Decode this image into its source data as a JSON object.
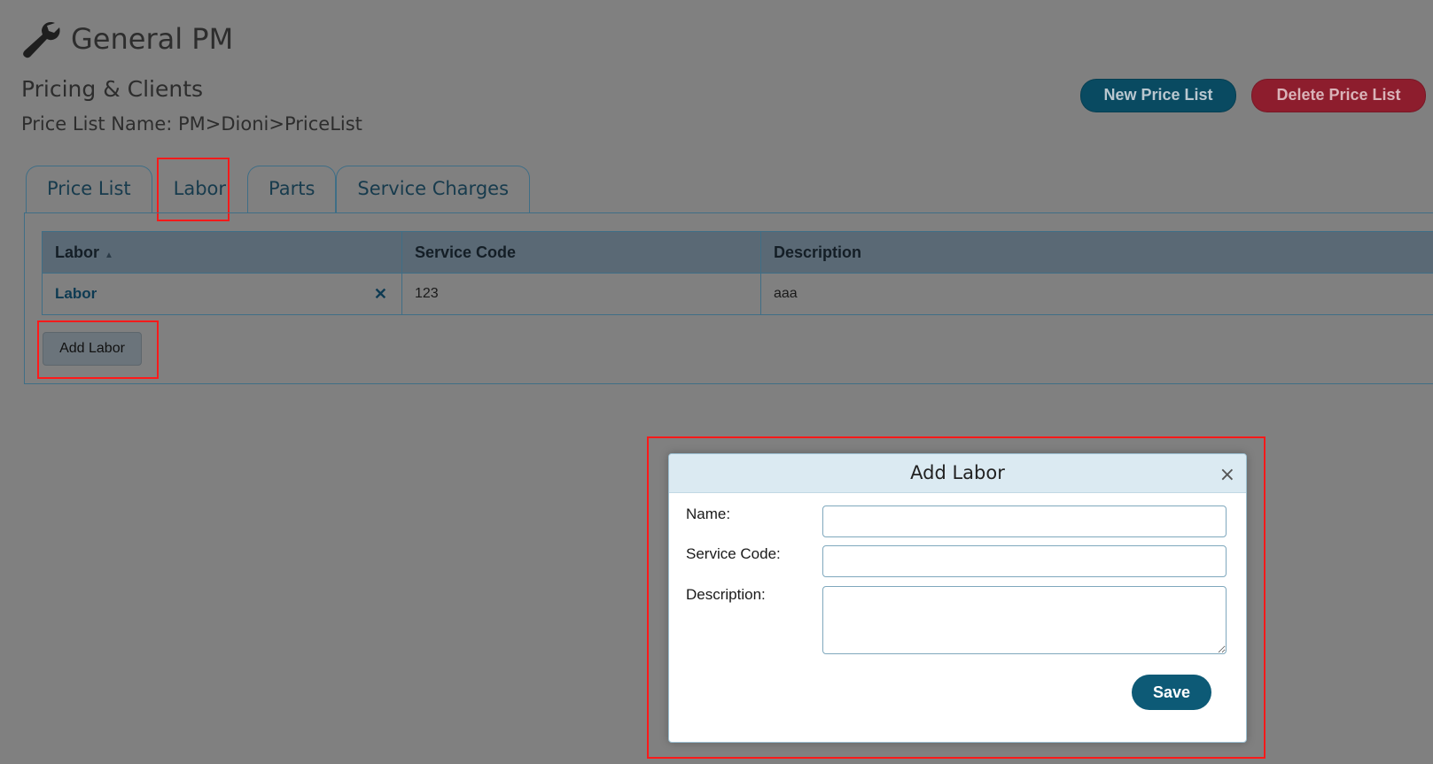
{
  "app": {
    "icon": "wrench-icon",
    "title": "General PM"
  },
  "subtitle": "Pricing & Clients",
  "price_list_name": "Price List Name: PM>Dioni>PriceList",
  "actions": {
    "new_price_list": "New Price List",
    "delete_price_list": "Delete Price List"
  },
  "tabs": [
    {
      "label": "Price List",
      "active": false
    },
    {
      "label": "Labor",
      "active": true
    },
    {
      "label": "Parts",
      "active": false
    },
    {
      "label": "Service Charges",
      "active": false
    }
  ],
  "table": {
    "columns": [
      "Labor",
      "Service Code",
      "Description"
    ],
    "sort_indicator": "▲",
    "rows": [
      {
        "labor": "Labor",
        "delete_icon": "✕",
        "service_code": "123",
        "description": "aaa"
      }
    ]
  },
  "add_button": "Add Labor",
  "modal": {
    "title": "Add Labor",
    "close": "×",
    "fields": {
      "name_label": "Name:",
      "name_value": "",
      "service_code_label": "Service Code:",
      "service_code_value": "",
      "description_label": "Description:",
      "description_value": ""
    },
    "save": "Save"
  },
  "colors": {
    "highlight": "#ff1a1a",
    "primary": "#0d5a76",
    "danger": "#8d1d2d"
  }
}
